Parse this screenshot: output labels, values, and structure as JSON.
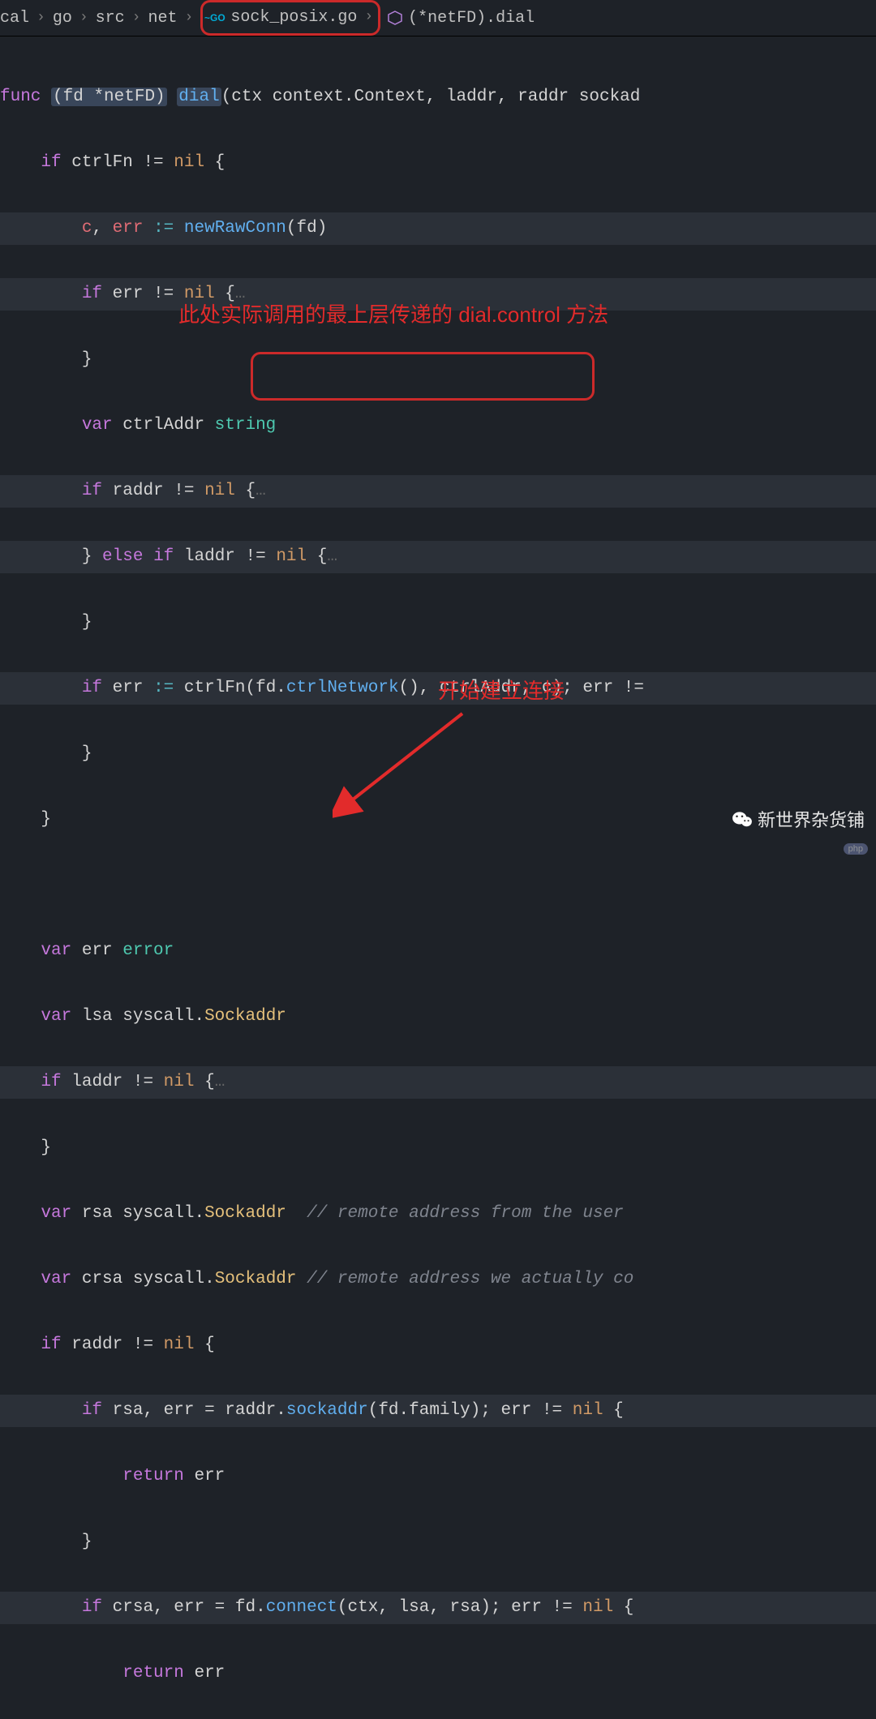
{
  "breadcrumb": {
    "c0": "cal",
    "c1": "go",
    "c2": "src",
    "c3": "net",
    "c4": "sock_posix.go",
    "c5": "(*netFD).dial",
    "sep": "›"
  },
  "code": {
    "l1_func": "func",
    "l1_recv": "(fd *netFD)",
    "l1_name": "dial",
    "l1_sig": "(ctx context.Context, laddr, raddr sockad",
    "l2_if": "if",
    "l2_cond": " ctrlFn != ",
    "l2_nil": "nil",
    "l2_brace": " {",
    "l3_c": "c",
    "l3_err": "err",
    "l3_assign": " := ",
    "l3_fn": "newRawConn",
    "l3_args": "(fd)",
    "l4_if": "if",
    "l4_err": " err != ",
    "l4_nil": "nil",
    "l4_brace": " {",
    "l4_fold": "…",
    "l5_brace": "}",
    "l6_var": "var",
    "l6_name": " ctrlAddr ",
    "l6_type": "string",
    "l7_if": "if",
    "l7_cond": " raddr != ",
    "l7_nil": "nil",
    "l7_brace": " {",
    "l7_fold": "…",
    "l8_pre": "} ",
    "l8_else": "else",
    "l8_if": " if",
    "l8_cond": " laddr != ",
    "l8_nil": "nil",
    "l8_brace": " {",
    "l8_fold": "…",
    "l9_brace": "}",
    "l10_if": "if",
    "l10_err": " err ",
    "l10_assign": ":=",
    "l10_fn": " ctrlFn",
    "l10_arg1": "(fd.",
    "l10_arg1b": "ctrlNetwork",
    "l10_arg1c": "(),",
    "l10_rest": " ctrlAddr, c); err !=",
    "l11_brace": "}",
    "l12_brace": "}",
    "l14_var": "var",
    "l14_err": " err ",
    "l14_type": "error",
    "l15_var": "var",
    "l15_name": " lsa ",
    "l15_pkg": "syscall",
    "l15_dot": ".",
    "l15_type": "Sockaddr",
    "l16_if": "if",
    "l16_cond": " laddr != ",
    "l16_nil": "nil",
    "l16_brace": " {",
    "l16_fold": "…",
    "l17_brace": "}",
    "l18_var": "var",
    "l18_name": " rsa ",
    "l18_pkg": "syscall",
    "l18_type": "Sockaddr",
    "l18_cmt": "  // remote address from the user",
    "l19_var": "var",
    "l19_name": " crsa ",
    "l19_pkg": "syscall",
    "l19_type": "Sockaddr",
    "l19_cmt": " // remote address we actually co",
    "l20_if": "if",
    "l20_cond": " raddr != ",
    "l20_nil": "nil",
    "l20_brace": " {",
    "l21_if": "if",
    "l21_lhs": " rsa, err = raddr.",
    "l21_call": "sockaddr",
    "l21_args": "(fd.family); err != ",
    "l21_nil": "nil",
    "l21_brace": " {",
    "l22_ret": "return",
    "l22_err": " err",
    "l23_brace": "}",
    "l24_if": "if",
    "l24_lhs": " crsa, err = fd.",
    "l24_call": "connect",
    "l24_args": "(ctx, lsa, rsa); err != ",
    "l24_nil": "nil",
    "l24_brace": " {",
    "l25_ret": "return",
    "l25_err": " err"
  },
  "annotations": {
    "a1": "此处实际调用的最上层传递的 dial.control 方法",
    "a2": "开始建立连接"
  },
  "watermark": {
    "text": "新世界杂货铺"
  },
  "badge": {
    "text": "php"
  }
}
